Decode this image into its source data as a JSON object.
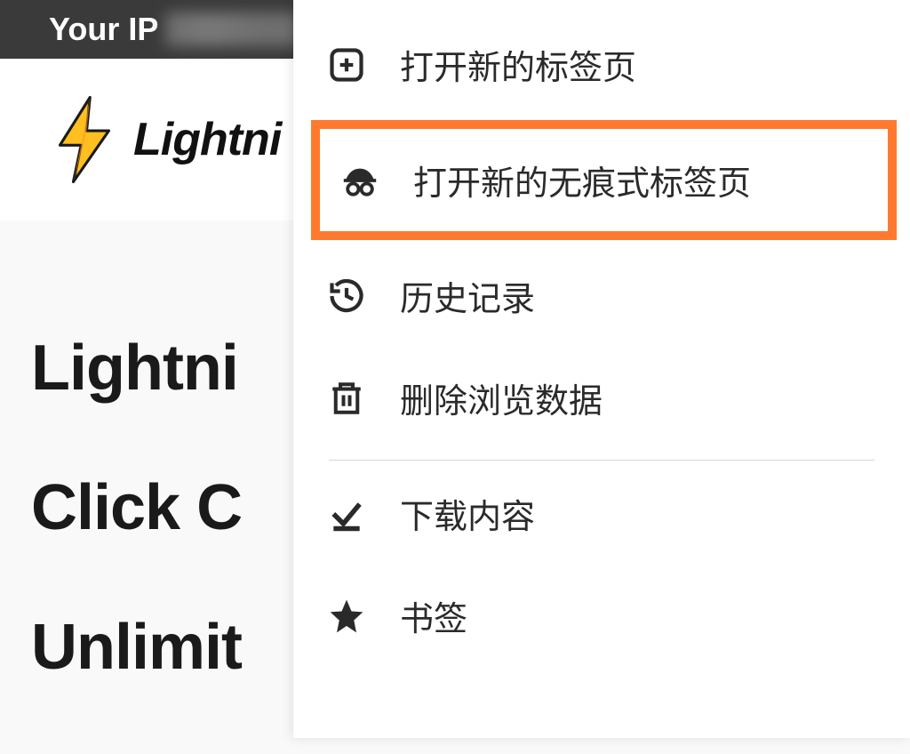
{
  "topbar": {
    "ip_label": "Your IP"
  },
  "brand": {
    "name": "Lightni"
  },
  "content": {
    "line1": "Lightni",
    "line2": "Click C",
    "line3": "Unlimit"
  },
  "menu": {
    "new_tab": "打开新的标签页",
    "new_incognito": "打开新的无痕式标签页",
    "history": "历史记录",
    "clear_data": "删除浏览数据",
    "downloads": "下载内容",
    "bookmarks": "书签"
  }
}
